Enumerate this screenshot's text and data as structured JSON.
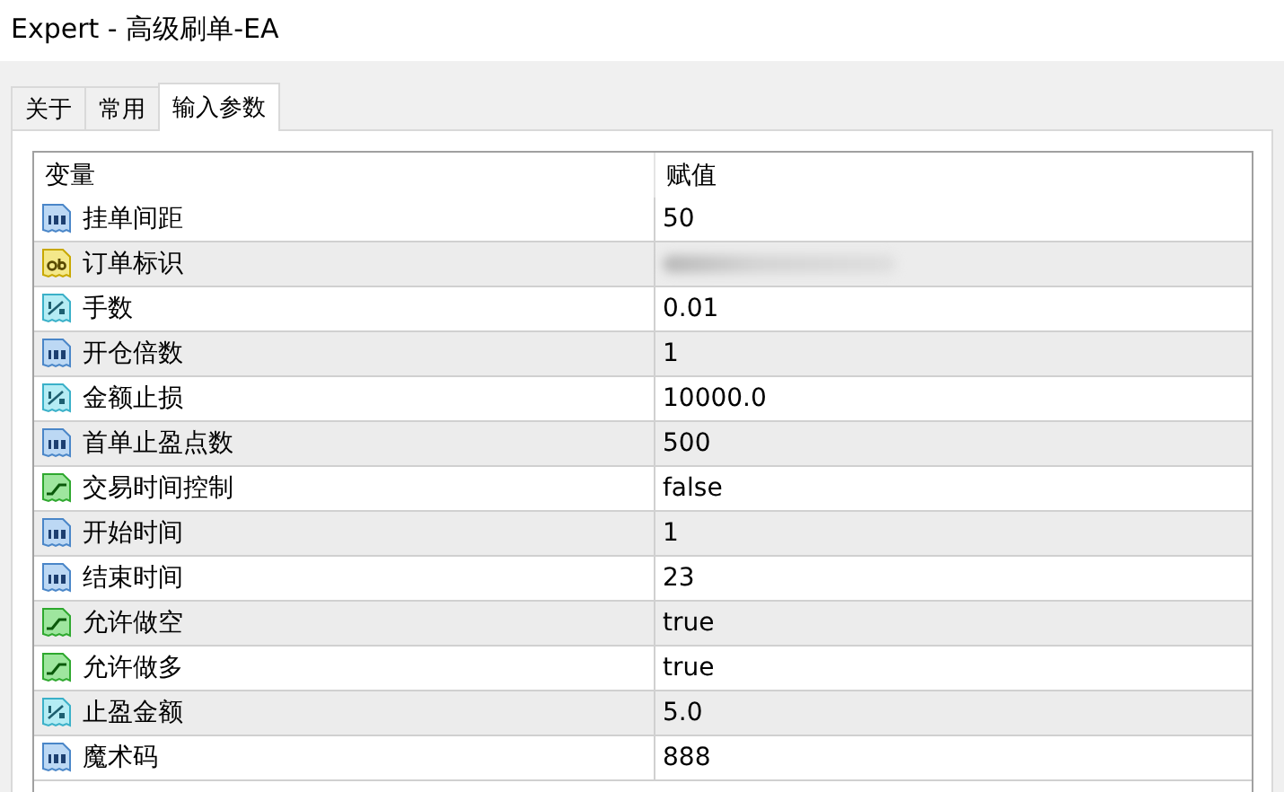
{
  "window": {
    "title": "Expert - 高级刷单-EA"
  },
  "tabs": [
    {
      "label": "关于",
      "selected": false
    },
    {
      "label": "常用",
      "selected": false
    },
    {
      "label": "输入参数",
      "selected": true
    }
  ],
  "table": {
    "columns": [
      "变量",
      "赋值"
    ],
    "rows": [
      {
        "kind": "int",
        "name": "挂单间距",
        "value": "50"
      },
      {
        "kind": "string",
        "name": "订单标识",
        "value_hidden": true
      },
      {
        "kind": "double",
        "name": "手数",
        "value": "0.01"
      },
      {
        "kind": "int",
        "name": "开仓倍数",
        "value": "1"
      },
      {
        "kind": "double",
        "name": "金额止损",
        "value": "10000.0"
      },
      {
        "kind": "int",
        "name": "首单止盈点数",
        "value": "500"
      },
      {
        "kind": "bool",
        "name": "交易时间控制",
        "value": "false"
      },
      {
        "kind": "int",
        "name": "开始时间",
        "value": "1"
      },
      {
        "kind": "int",
        "name": "结束时间",
        "value": "23"
      },
      {
        "kind": "bool",
        "name": "允许做空",
        "value": "true"
      },
      {
        "kind": "bool",
        "name": "允许做多",
        "value": "true"
      },
      {
        "kind": "double",
        "name": "止盈金额",
        "value": "5.0"
      },
      {
        "kind": "int",
        "name": "魔术码",
        "value": "888"
      }
    ]
  }
}
